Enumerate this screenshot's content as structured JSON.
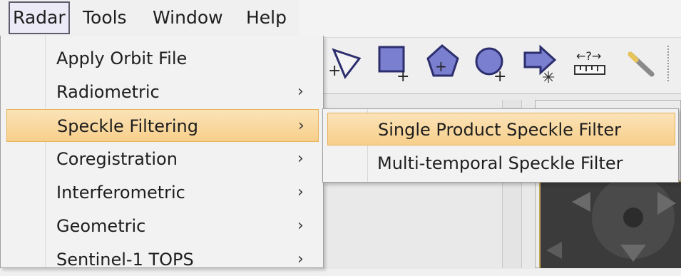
{
  "menubar": {
    "items": [
      {
        "label": "Radar"
      },
      {
        "label": "Tools"
      },
      {
        "label": "Window"
      },
      {
        "label": "Help"
      }
    ]
  },
  "radar_menu": {
    "items": [
      {
        "label": "Apply Orbit File",
        "has_submenu": false
      },
      {
        "label": "Radiometric",
        "has_submenu": true,
        "arrow": "›"
      },
      {
        "label": "Speckle Filtering",
        "has_submenu": true,
        "arrow": "›"
      },
      {
        "label": "Coregistration",
        "has_submenu": true,
        "arrow": "›"
      },
      {
        "label": "Interferometric",
        "has_submenu": true,
        "arrow": "›"
      },
      {
        "label": "Geometric",
        "has_submenu": true,
        "arrow": "›"
      },
      {
        "label": "Sentinel-1 TOPS",
        "has_submenu": true,
        "arrow": "›"
      }
    ]
  },
  "speckle_submenu": {
    "items": [
      {
        "label": "Single Product Speckle Filter"
      },
      {
        "label": "Multi-temporal Speckle Filter"
      }
    ]
  },
  "toolbar": {
    "icons": [
      "polyline-draw-icon",
      "rectangle-draw-icon",
      "polygon-draw-icon",
      "ellipse-draw-icon",
      "magic-wand-selection-icon",
      "range-finder-icon",
      "wand-tool-icon"
    ]
  },
  "colors": {
    "highlight_top": "#fbe3b8",
    "highlight_bottom": "#f7cf8a",
    "highlight_border": "#e6b25a",
    "tool_fill": "#7b7fd0",
    "tool_stroke": "#2c2e6e"
  }
}
